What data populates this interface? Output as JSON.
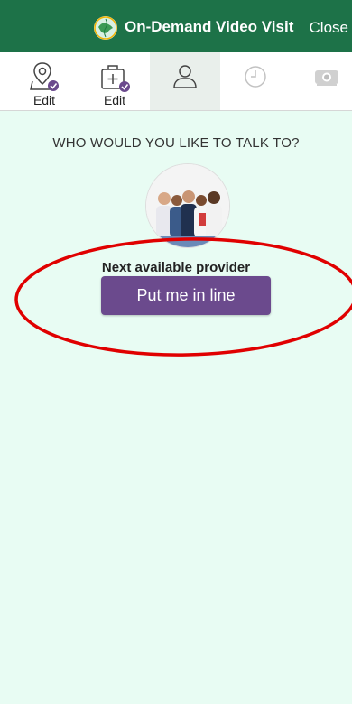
{
  "header": {
    "title": "On-Demand Video Visit",
    "close_label": "Close",
    "logo_icon": "globe-logo-icon",
    "bg_color": "#1d7248"
  },
  "steps": [
    {
      "icon": "location-icon",
      "label": "Edit",
      "completed": true
    },
    {
      "icon": "medical-kit-icon",
      "label": "Edit",
      "completed": true
    },
    {
      "icon": "person-icon",
      "label": "",
      "active": true
    },
    {
      "icon": "clock-icon",
      "label": ""
    },
    {
      "icon": "camera-icon",
      "label": ""
    }
  ],
  "main": {
    "question": "WHO WOULD YOU LIKE TO TALK TO?",
    "provider_name": "Next available provider",
    "button_label": "Put me in line",
    "button_color": "#6b4a8d",
    "bg_color": "#e8fcf3"
  },
  "annotation": {
    "shape": "ellipse",
    "color": "#e00000"
  }
}
